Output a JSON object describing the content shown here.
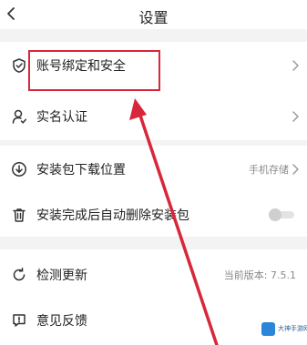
{
  "header": {
    "title": "设置"
  },
  "rows": {
    "account": {
      "label": "账号绑定和安全"
    },
    "realname": {
      "label": "实名认证"
    },
    "download": {
      "label": "安装包下载位置",
      "value": "手机存储"
    },
    "autodelete": {
      "label": "安装完成后自动删除安装包",
      "toggle_on": false
    },
    "update": {
      "label": "检测更新",
      "value": "当前版本: 7.5.1"
    },
    "feedback": {
      "label": "意见反馈"
    }
  },
  "watermark": {
    "text": "大神手游网"
  },
  "colors": {
    "highlight": "#d8263a",
    "separator": "#f3f3f3",
    "secondary_text": "#8a8a8a"
  }
}
